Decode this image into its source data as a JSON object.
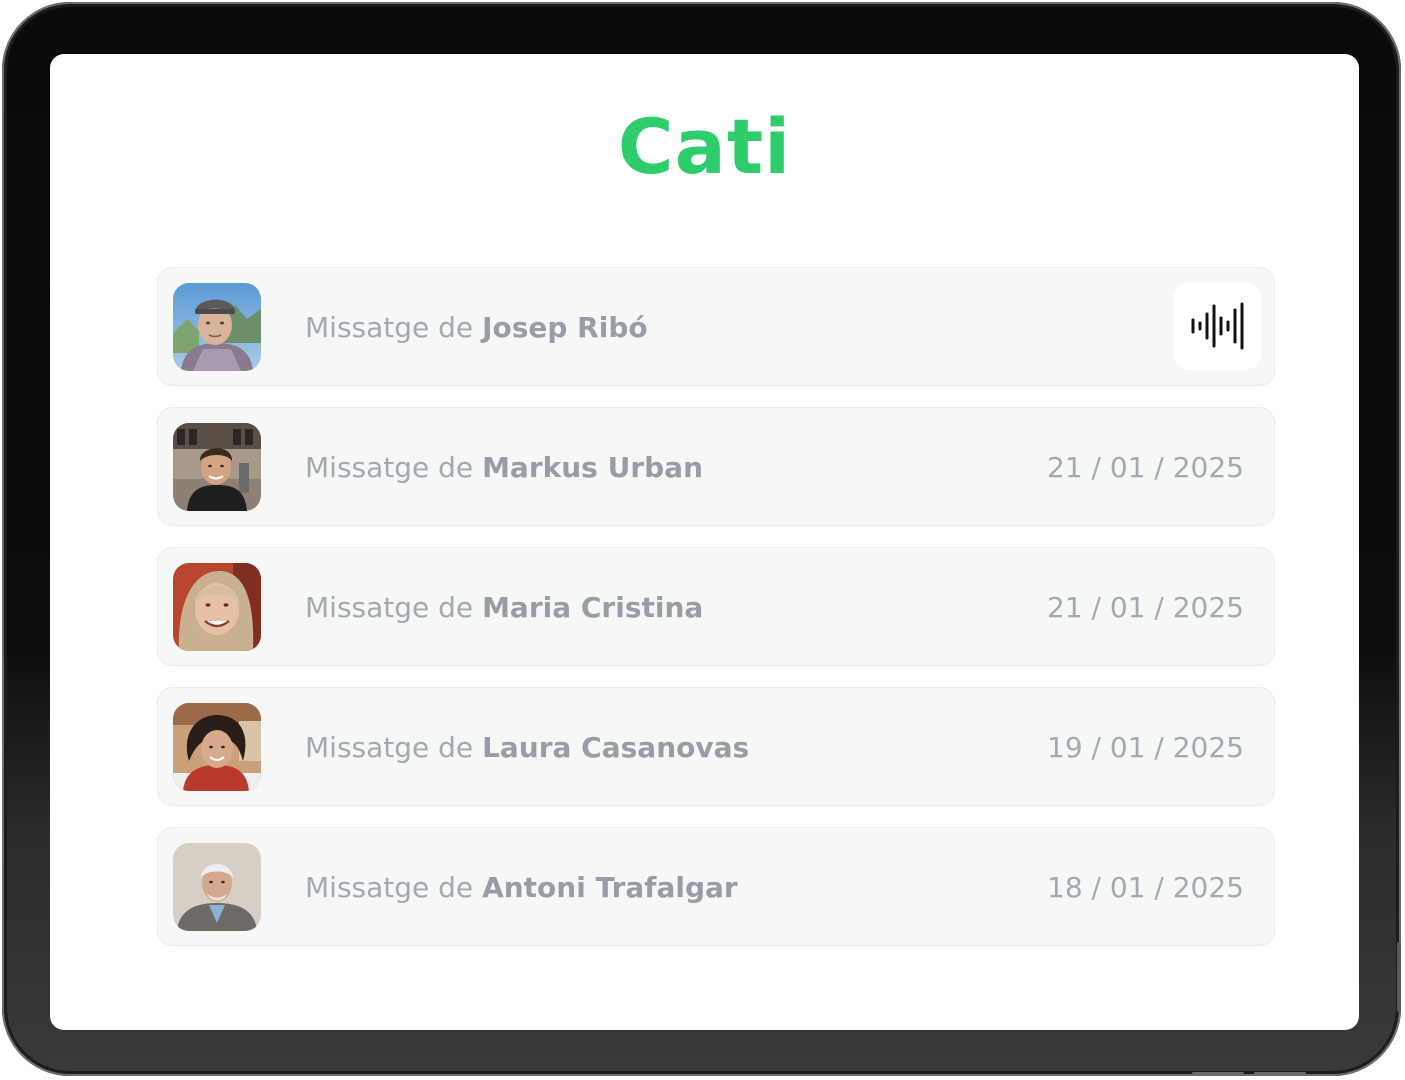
{
  "app": {
    "title": "Cati",
    "accent_color": "#2ecc6a"
  },
  "messages": [
    {
      "prefix": "Missatge de ",
      "sender": "Josep Ribó",
      "date": "",
      "status": "playing",
      "trailing_icon": "audio-waveform-icon",
      "avatar": "elderly-man-with-cap-photo"
    },
    {
      "prefix": "Missatge de ",
      "sender": "Markus Urban",
      "date": "21 / 01 / 2025",
      "avatar": "young-man-street-photo"
    },
    {
      "prefix": "Missatge de ",
      "sender": "Maria Cristina",
      "date": "21 / 01 / 2025",
      "avatar": "smiling-woman-photo"
    },
    {
      "prefix": "Missatge de ",
      "sender": "Laura Casanovas",
      "date": "19 / 01 / 2025",
      "avatar": "woman-curly-hair-photo"
    },
    {
      "prefix": "Missatge de ",
      "sender": "Antoni Trafalgar",
      "date": "18 / 01 / 2025",
      "avatar": "elderly-man-suit-photo"
    }
  ]
}
